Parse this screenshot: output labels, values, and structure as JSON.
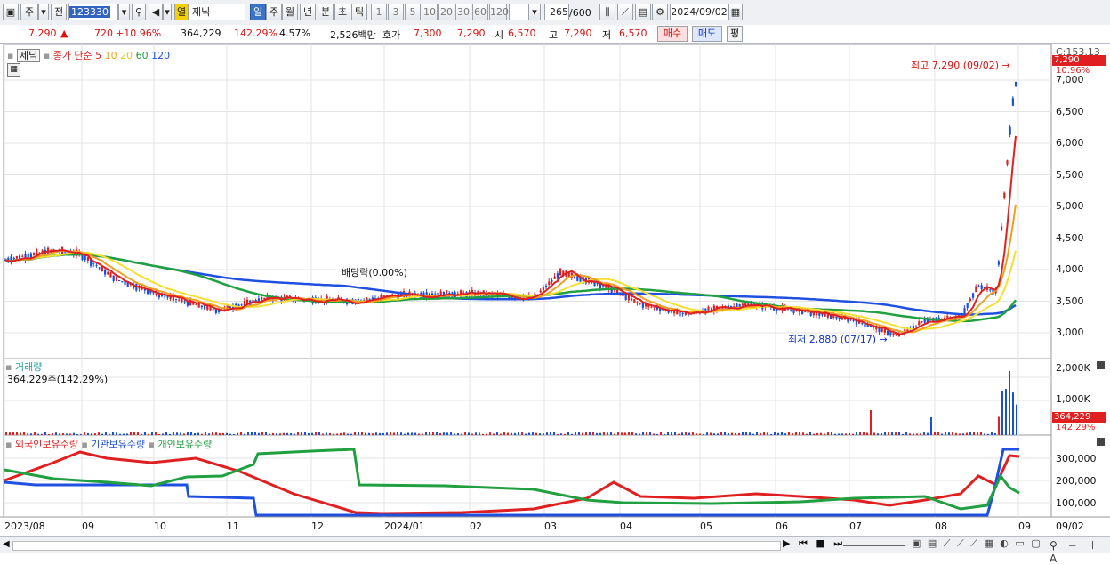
{
  "toolbar": {
    "main_label": "주",
    "prev_label": "전",
    "code": "123330",
    "sort_label": "열",
    "stock_name": "제닉",
    "periods": [
      "일",
      "주",
      "월",
      "년",
      "분",
      "초",
      "틱"
    ],
    "intervals": [
      "1",
      "3",
      "5",
      "10",
      "20",
      "30",
      "60",
      "120"
    ],
    "count": "265",
    "count_total": "/600",
    "date": "2024/09/02"
  },
  "quote": {
    "price": "7,290",
    "change": "720",
    "change_pct": "+10.96%",
    "volume": "364,229",
    "volume_ratio": "142.29%",
    "turnover": "4.57%",
    "amount": "2,526백만",
    "ask_label": "호가",
    "ask": "7,300",
    "bid": "7,290",
    "open_label": "시",
    "open": "6,570",
    "high_label": "고",
    "high": "7,290",
    "low_label": "저",
    "low": "6,570",
    "buy_label": "매수",
    "sell_label": "매도",
    "avg_label": "평"
  },
  "price_panel": {
    "name": "제닉",
    "ma_title": "종가 단순",
    "ma_periods": [
      "5",
      "10",
      "20",
      "60",
      "120"
    ],
    "ma_colors": [
      "#e02020",
      "#f0a020",
      "#f4e030",
      "#20a040",
      "#2050e0"
    ],
    "c_value": "C:153.13",
    "last_price": "7,290",
    "last_pct": "10.96%",
    "high_annot": "최고 7,290 (09/02)",
    "low_annot": "최저 2,880 (07/17)",
    "dividend_annot": "배당락(0.00%)",
    "y_ticks": [
      "7,000",
      "6,500",
      "6,000",
      "5,500",
      "5,000",
      "4,500",
      "4,000",
      "3,500",
      "3,000"
    ]
  },
  "volume_panel": {
    "title": "거래량",
    "value": "364,229주(142.29%)",
    "y_ticks": [
      "2,000K",
      "1,000K"
    ],
    "last": "364,229",
    "last_pct": "142.29%"
  },
  "holdings_panel": {
    "legend": [
      "외국인보유수량",
      "기관보유수량",
      "개인보유수량"
    ],
    "legend_colors": [
      "#e02020",
      "#2050e0",
      "#20a040"
    ],
    "y_ticks": [
      "300,000",
      "200,000",
      "100,000"
    ]
  },
  "x_axis": {
    "labels": [
      "2023/08",
      "09",
      "10",
      "11",
      "12",
      "2024/01",
      "02",
      "03",
      "04",
      "05",
      "06",
      "07",
      "08",
      "09"
    ],
    "right_label": "09/02"
  }
}
